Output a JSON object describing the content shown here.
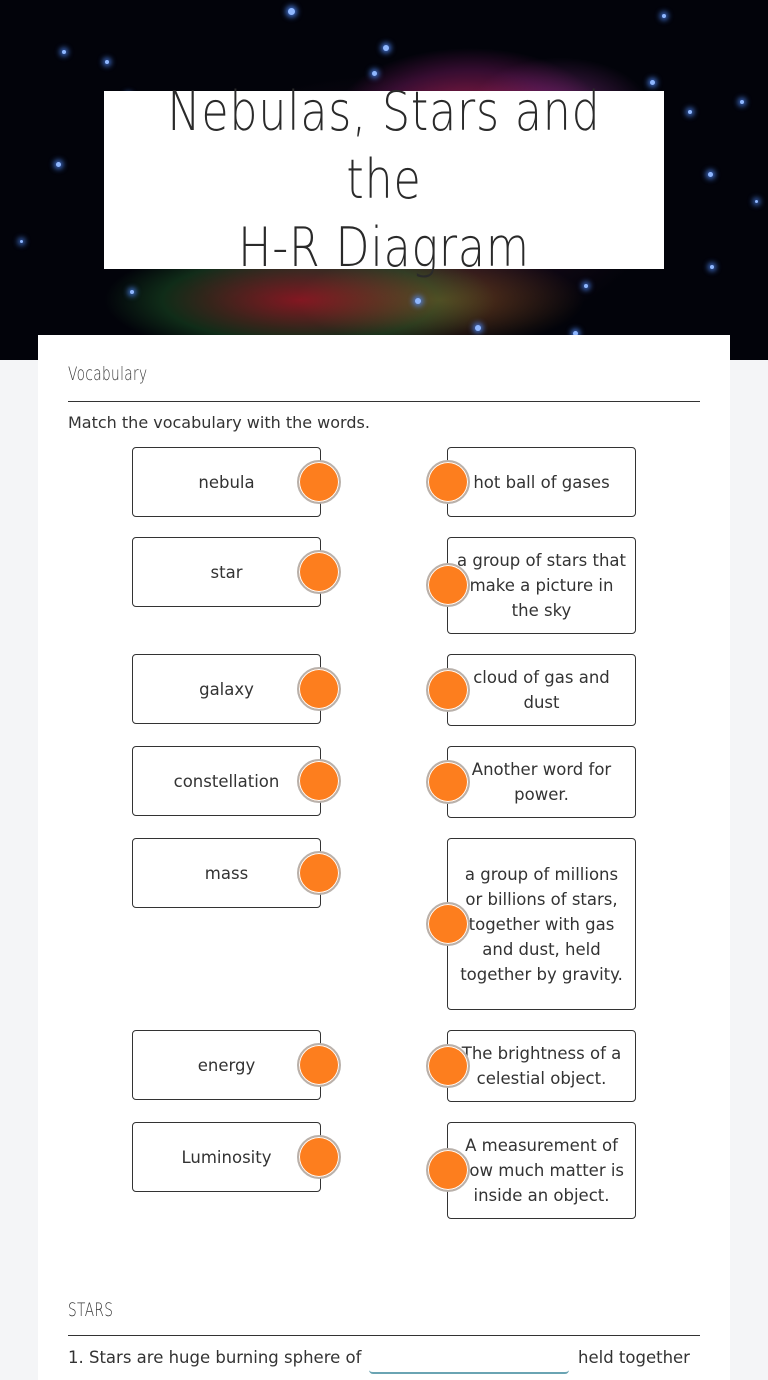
{
  "header": {
    "title": "Nebulas, Stars and the H-R Diagram",
    "title_line1": "Nebulas, Stars and the",
    "title_line2": "H-R Diagram"
  },
  "vocabulary": {
    "section_title": "Vocabulary",
    "instruction": "Match the vocabulary with the words.",
    "terms": [
      "nebula",
      "star",
      "galaxy",
      "constellation",
      "mass",
      "energy",
      "Luminosity"
    ],
    "definitions": [
      "hot ball of gases",
      "a group of stars that make a picture in the sky",
      "cloud of gas and dust",
      "Another word for power.",
      "a group of millions or billions of stars, together with gas and dust, held together by gravity.",
      "The brightness of a celestial object.",
      "A measurement of how much matter is inside an object."
    ],
    "connector_color": "#fd7e1e"
  },
  "stars": {
    "section_title": "STARS",
    "question1_prefix": "1. Stars are huge burning sphere of",
    "question1_value": "",
    "question1_suffix": "held together"
  }
}
